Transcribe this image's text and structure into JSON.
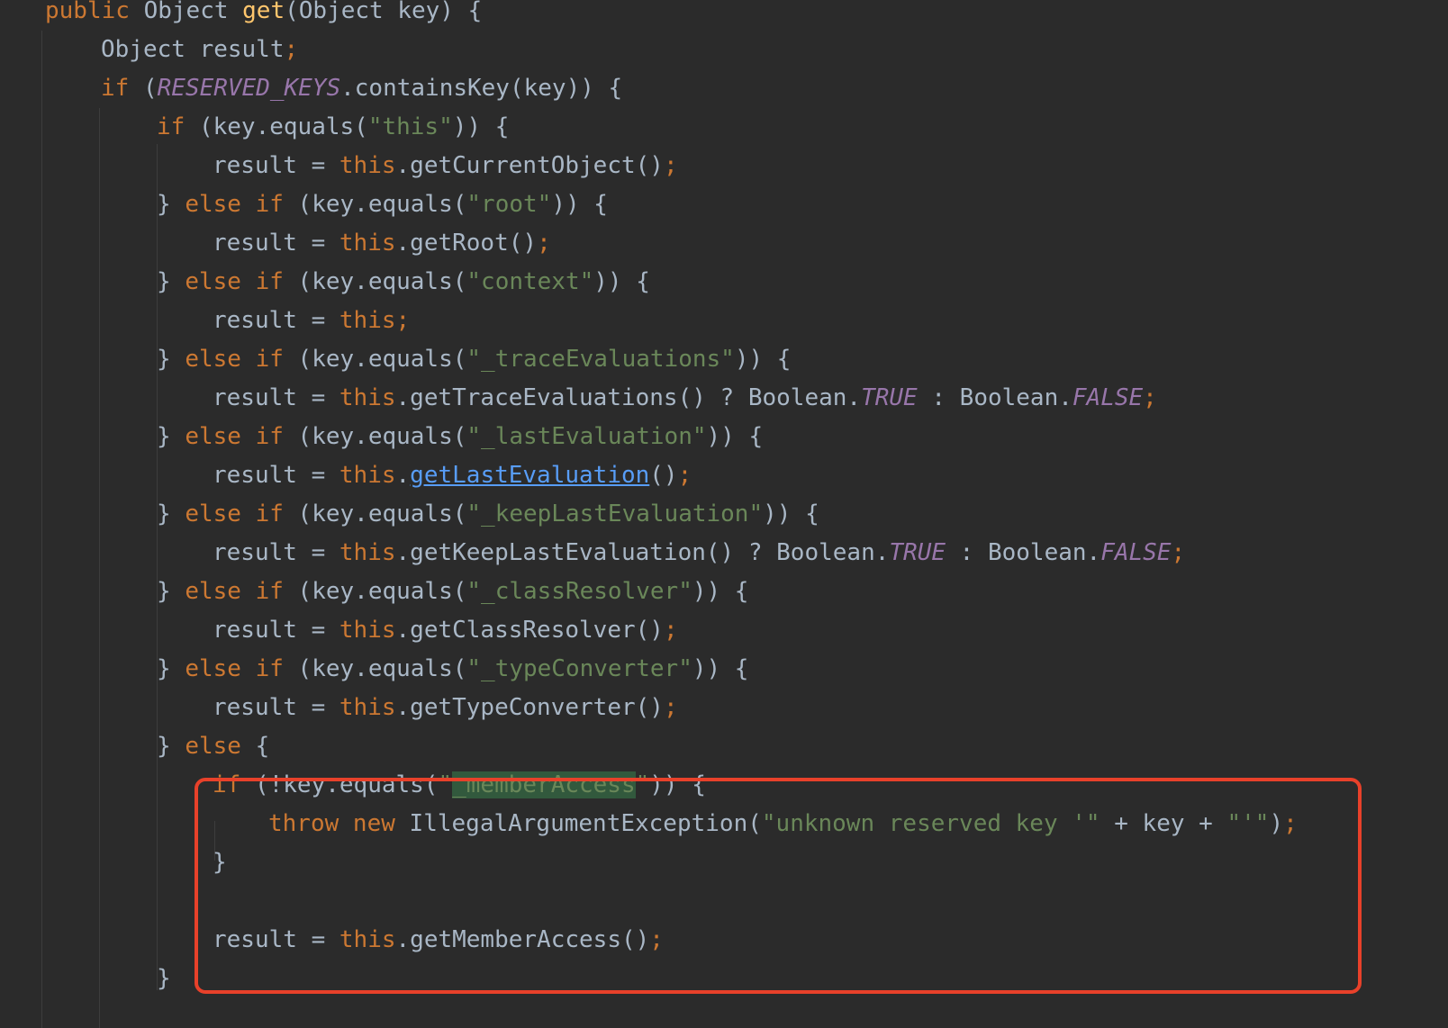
{
  "editor": {
    "language": "java",
    "colors": {
      "background": "#2b2b2b",
      "text": "#a9b7c6",
      "keyword": "#cc7832",
      "method_declaration": "#ffc66d",
      "constant": "#9876aa",
      "string": "#6a8759",
      "link": "#589df6",
      "search_match_background": "#32593d",
      "annotation_box": "#e8412a"
    },
    "lines": [
      [
        [
          "kw",
          "public "
        ],
        [
          "txt",
          "Object "
        ],
        [
          "fn",
          "get"
        ],
        [
          "txt",
          "(Object key) {"
        ]
      ],
      [
        [
          "txt",
          "Object result"
        ],
        [
          "semi",
          ";"
        ]
      ],
      [
        [
          "kw",
          "if "
        ],
        [
          "txt",
          "("
        ],
        [
          "const",
          "RESERVED_KEYS"
        ],
        [
          "txt",
          ".containsKey(key)) {"
        ]
      ],
      [
        [
          "kw",
          "if "
        ],
        [
          "txt",
          "(key.equals("
        ],
        [
          "str",
          "\"this\""
        ],
        [
          "txt",
          ")) {"
        ]
      ],
      [
        [
          "txt",
          "result = "
        ],
        [
          "kw",
          "this"
        ],
        [
          "txt",
          ".getCurrentObject()"
        ],
        [
          "semi",
          ";"
        ]
      ],
      [
        [
          "txt",
          "} "
        ],
        [
          "kw",
          "else if "
        ],
        [
          "txt",
          "(key.equals("
        ],
        [
          "str",
          "\"root\""
        ],
        [
          "txt",
          ")) {"
        ]
      ],
      [
        [
          "txt",
          "result = "
        ],
        [
          "kw",
          "this"
        ],
        [
          "txt",
          ".getRoot()"
        ],
        [
          "semi",
          ";"
        ]
      ],
      [
        [
          "txt",
          "} "
        ],
        [
          "kw",
          "else if "
        ],
        [
          "txt",
          "(key.equals("
        ],
        [
          "str",
          "\"context\""
        ],
        [
          "txt",
          ")) {"
        ]
      ],
      [
        [
          "txt",
          "result = "
        ],
        [
          "kw",
          "this"
        ],
        [
          "semi",
          ";"
        ]
      ],
      [
        [
          "txt",
          "} "
        ],
        [
          "kw",
          "else if "
        ],
        [
          "txt",
          "(key.equals("
        ],
        [
          "str",
          "\"_traceEvaluations\""
        ],
        [
          "txt",
          ")) {"
        ]
      ],
      [
        [
          "txt",
          "result = "
        ],
        [
          "kw",
          "this"
        ],
        [
          "txt",
          ".getTraceEvaluations() ? Boolean."
        ],
        [
          "const",
          "TRUE"
        ],
        [
          "txt",
          " : Boolean."
        ],
        [
          "const",
          "FALSE"
        ],
        [
          "semi",
          ";"
        ]
      ],
      [
        [
          "txt",
          "} "
        ],
        [
          "kw",
          "else if "
        ],
        [
          "txt",
          "(key.equals("
        ],
        [
          "str",
          "\"_lastEvaluation\""
        ],
        [
          "txt",
          ")) {"
        ]
      ],
      [
        [
          "txt",
          "result = "
        ],
        [
          "kw",
          "this"
        ],
        [
          "txt",
          "."
        ],
        [
          "link",
          "getLastEvaluation"
        ],
        [
          "txt",
          "()"
        ],
        [
          "semi",
          ";"
        ]
      ],
      [
        [
          "txt",
          "} "
        ],
        [
          "kw",
          "else if "
        ],
        [
          "txt",
          "(key.equals("
        ],
        [
          "str",
          "\"_keepLastEvaluation\""
        ],
        [
          "txt",
          ")) {"
        ]
      ],
      [
        [
          "txt",
          "result = "
        ],
        [
          "kw",
          "this"
        ],
        [
          "txt",
          ".getKeepLastEvaluation() ? Boolean."
        ],
        [
          "const",
          "TRUE"
        ],
        [
          "txt",
          " : Boolean."
        ],
        [
          "const",
          "FALSE"
        ],
        [
          "semi",
          ";"
        ]
      ],
      [
        [
          "txt",
          "} "
        ],
        [
          "kw",
          "else if "
        ],
        [
          "txt",
          "(key.equals("
        ],
        [
          "str",
          "\"_classResolver\""
        ],
        [
          "txt",
          ")) {"
        ]
      ],
      [
        [
          "txt",
          "result = "
        ],
        [
          "kw",
          "this"
        ],
        [
          "txt",
          ".getClassResolver()"
        ],
        [
          "semi",
          ";"
        ]
      ],
      [
        [
          "txt",
          "} "
        ],
        [
          "kw",
          "else if "
        ],
        [
          "txt",
          "(key.equals("
        ],
        [
          "str",
          "\"_typeConverter\""
        ],
        [
          "txt",
          ")) {"
        ]
      ],
      [
        [
          "txt",
          "result = "
        ],
        [
          "kw",
          "this"
        ],
        [
          "txt",
          ".getTypeConverter()"
        ],
        [
          "semi",
          ";"
        ]
      ],
      [
        [
          "txt",
          "} "
        ],
        [
          "kw",
          "else "
        ],
        [
          "txt",
          "{"
        ]
      ],
      [
        [
          "kw",
          "if "
        ],
        [
          "txt",
          "(!key.equals("
        ],
        [
          "str",
          "\""
        ],
        [
          "match",
          "_memberAccess"
        ],
        [
          "str",
          "\""
        ],
        [
          "txt",
          ")) {"
        ]
      ],
      [
        [
          "kw",
          "throw new "
        ],
        [
          "txt",
          "IllegalArgumentException("
        ],
        [
          "str",
          "\"unknown reserved key '\""
        ],
        [
          "txt",
          " + key + "
        ],
        [
          "str",
          "\"'\""
        ],
        [
          "txt",
          ")"
        ],
        [
          "semi",
          ";"
        ]
      ],
      [
        [
          "txt",
          "}"
        ]
      ],
      [],
      [
        [
          "txt",
          "result = "
        ],
        [
          "kw",
          "this"
        ],
        [
          "txt",
          ".getMemberAccess()"
        ],
        [
          "semi",
          ";"
        ]
      ],
      [
        [
          "txt",
          "}"
        ]
      ]
    ]
  }
}
